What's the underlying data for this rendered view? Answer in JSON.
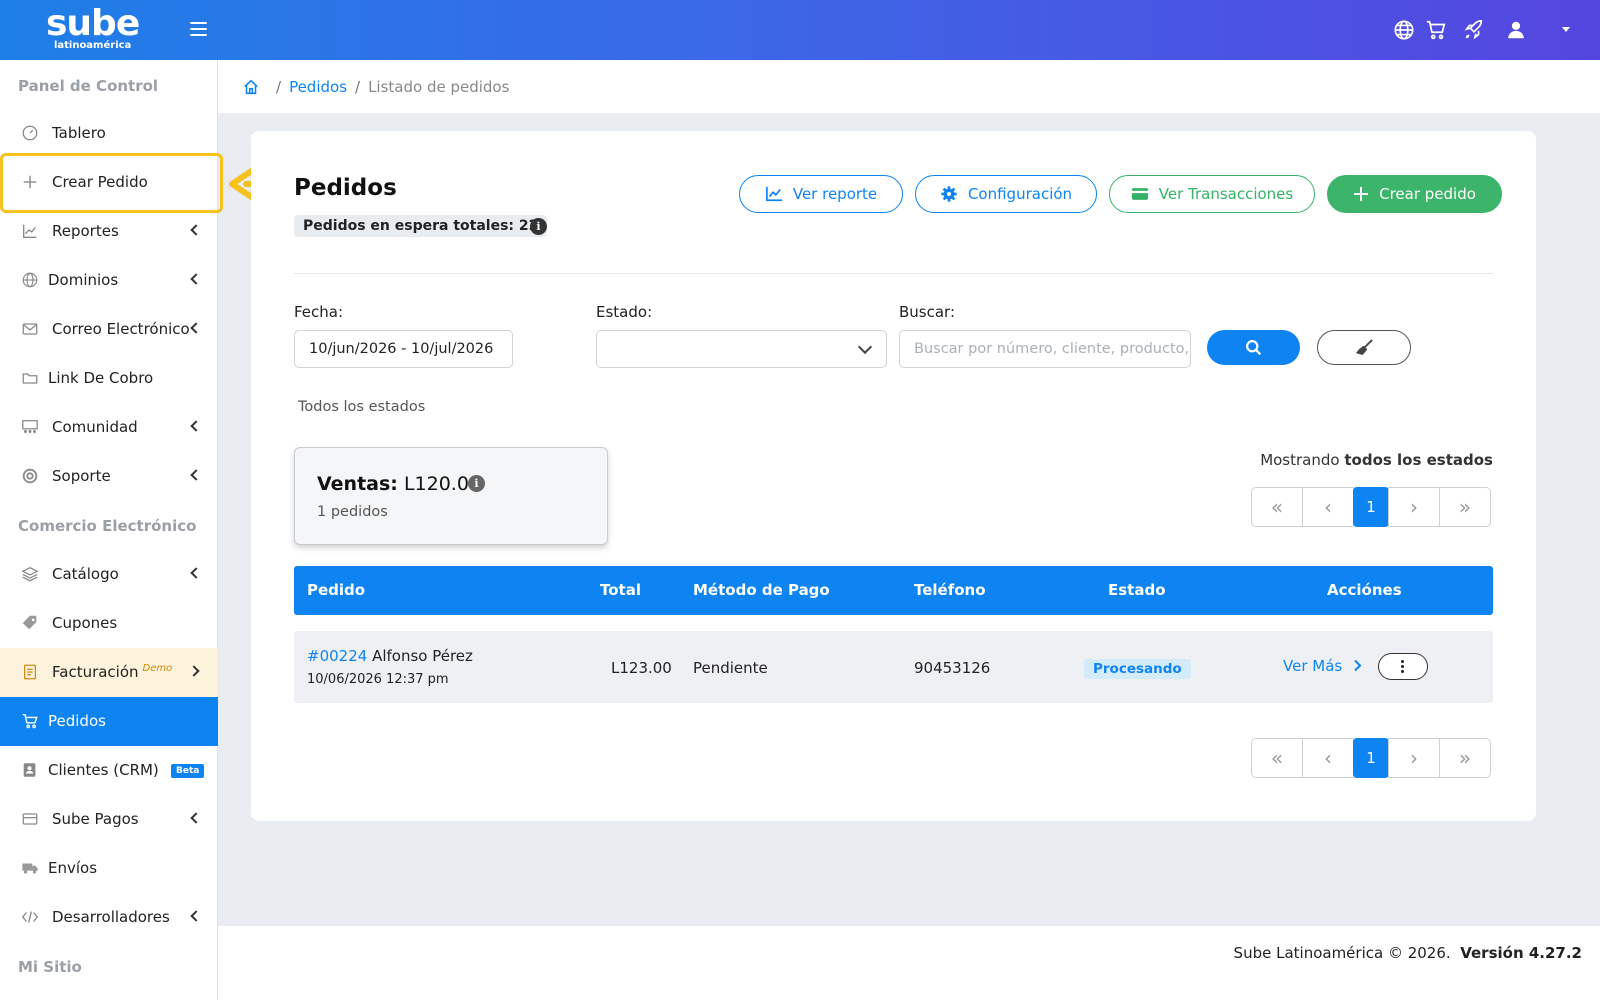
{
  "header": {
    "logo_main": "sube",
    "logo_sub": "latinoamérica"
  },
  "sidebar": {
    "section_panel": "Panel de Control",
    "section_ecommerce": "Comercio Electrónico",
    "section_site": "Mi Sitio",
    "items": [
      {
        "label": "Tablero"
      },
      {
        "label": "Crear Pedido"
      },
      {
        "label": "Reportes"
      },
      {
        "label": "Dominios"
      },
      {
        "label": "Correo Electrónico"
      },
      {
        "label": "Link De Cobro"
      },
      {
        "label": "Comunidad"
      },
      {
        "label": "Soporte"
      },
      {
        "label": "Catálogo"
      },
      {
        "label": "Cupones"
      },
      {
        "label": "Facturación",
        "sup": "Demo"
      },
      {
        "label": "Pedidos"
      },
      {
        "label": "Clientes (CRM)",
        "badge": "Beta"
      },
      {
        "label": "Sube Pagos"
      },
      {
        "label": "Envíos"
      },
      {
        "label": "Desarrolladores"
      }
    ]
  },
  "breadcrumb": {
    "sep": "/",
    "parent": "Pedidos",
    "current": "Listado de pedidos"
  },
  "page": {
    "title": "Pedidos",
    "pending_badge": "Pedidos en espera totales: 22",
    "info_glyph": "i"
  },
  "actions": {
    "report": "Ver reporte",
    "config": "Configuración",
    "transactions": "Ver Transacciones",
    "create": "Crear pedido"
  },
  "filters": {
    "date_label": "Fecha:",
    "date_value": "10/jun/2026 - 10/jul/2026",
    "status_label": "Estado:",
    "status_value": "",
    "search_label": "Buscar:",
    "search_placeholder": "Buscar por número, cliente, producto, t",
    "all_states": "Todos los estados"
  },
  "summary": {
    "sales_label": "Ventas:",
    "sales_value": "L120.00",
    "orders_count": "1 pedidos"
  },
  "showing": {
    "prefix": "Mostrando",
    "value": "todos los estados"
  },
  "pagination": {
    "first": "«",
    "prev": "‹",
    "current": "1",
    "next": "›",
    "last": "»"
  },
  "table": {
    "columns": [
      "Pedido",
      "Total",
      "Método de Pago",
      "Teléfono",
      "Estado",
      "Acciónes"
    ],
    "rows": [
      {
        "order_id": "#00224",
        "customer": "Alfonso Pérez",
        "date": "10/06/2026 12:37 pm",
        "total": "L123.00",
        "payment": "Pendiente",
        "phone": "90453126",
        "status": "Procesando",
        "action": "Ver Más"
      }
    ]
  },
  "footer": {
    "copyright": "Sube Latinoamérica © 2026.",
    "version": "Versión 4.27.2"
  },
  "colors": {
    "primary": "#0d84f2",
    "success": "#3cb56b",
    "highlight": "#f7c21e"
  }
}
